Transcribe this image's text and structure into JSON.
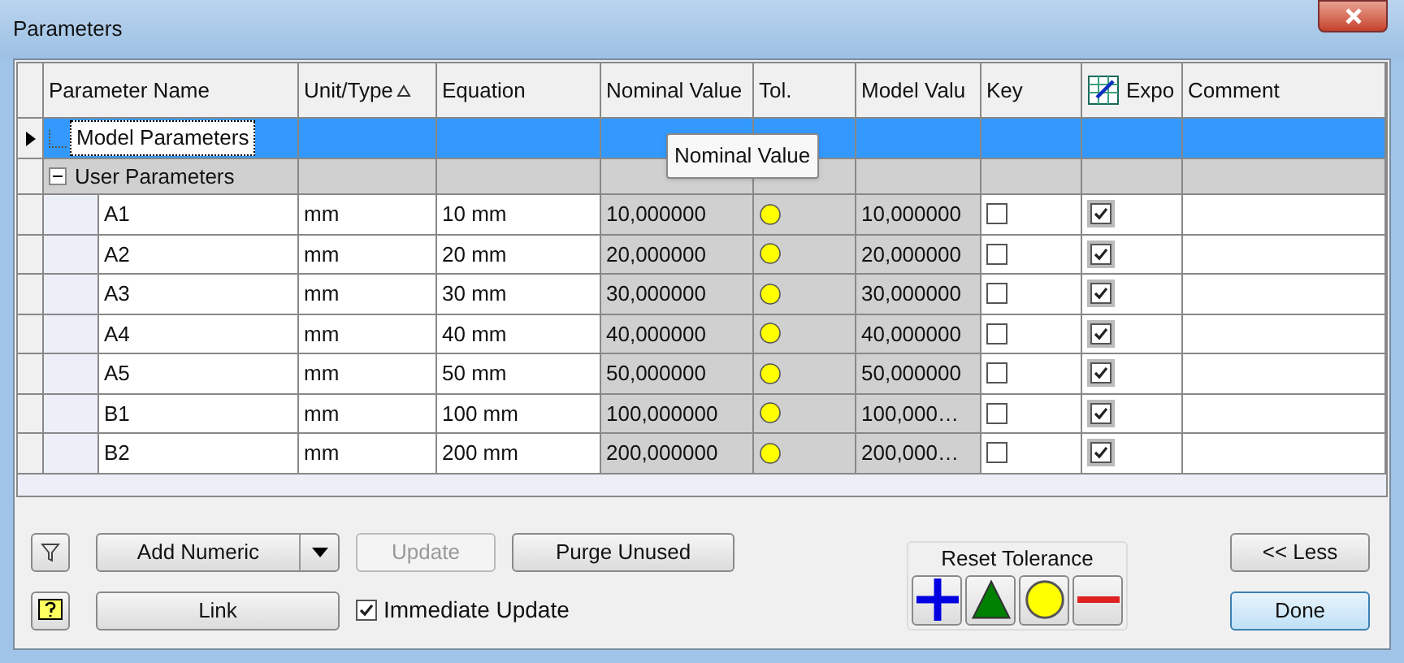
{
  "window": {
    "title": "Parameters"
  },
  "columns": [
    {
      "label": "Parameter Name"
    },
    {
      "label": "Unit/Type",
      "sorted": true
    },
    {
      "label": "Equation"
    },
    {
      "label": "Nominal Value"
    },
    {
      "label": "Tol."
    },
    {
      "label": "Model Valu"
    },
    {
      "label": "Key"
    },
    {
      "label": "Expo",
      "icon": true
    },
    {
      "label": "Comment"
    }
  ],
  "groups": [
    {
      "label": "Model Parameters",
      "selected": true
    },
    {
      "label": "User Parameters",
      "selected": false,
      "expanded": true,
      "children": [
        {
          "name": "A1",
          "unit": "mm",
          "equation": "10 mm",
          "nominal": "10,000000",
          "tol": {
            "kind": "nominal"
          },
          "model": "10,000000",
          "key": false,
          "export": true
        },
        {
          "name": "A2",
          "unit": "mm",
          "equation": "20 mm",
          "nominal": "20,000000",
          "tol": {
            "kind": "nominal"
          },
          "model": "20,000000",
          "key": false,
          "export": true
        },
        {
          "name": "A3",
          "unit": "mm",
          "equation": "30 mm",
          "nominal": "30,000000",
          "tol": {
            "kind": "nominal"
          },
          "model": "30,000000",
          "key": false,
          "export": true
        },
        {
          "name": "A4",
          "unit": "mm",
          "equation": "40 mm",
          "nominal": "40,000000",
          "tol": {
            "kind": "nominal"
          },
          "model": "40,000000",
          "key": false,
          "export": true
        },
        {
          "name": "A5",
          "unit": "mm",
          "equation": "50 mm",
          "nominal": "50,000000",
          "tol": {
            "kind": "nominal"
          },
          "model": "50,000000",
          "key": false,
          "export": true
        },
        {
          "name": "B1",
          "unit": "mm",
          "equation": "100 mm",
          "nominal": "100,000000",
          "tol": {
            "kind": "nominal"
          },
          "model": "100,000…",
          "key": false,
          "export": true
        },
        {
          "name": "B2",
          "unit": "mm",
          "equation": "200 mm",
          "nominal": "200,000000",
          "tol": {
            "kind": "nominal"
          },
          "model": "200,000…",
          "key": false,
          "export": true
        }
      ]
    }
  ],
  "tooltip": "Nominal Value",
  "buttons": {
    "add_numeric": "Add Numeric",
    "update": {
      "label": "Update",
      "disabled": true
    },
    "purge": "Purge Unused",
    "link": "Link",
    "less": "<< Less",
    "done": "Done"
  },
  "immediate_update": {
    "label": "Immediate Update",
    "checked": true
  },
  "reset_tolerance": {
    "label": "Reset Tolerance",
    "tols": [
      {
        "kind": "upper"
      },
      {
        "kind": "median"
      },
      {
        "kind": "nominal"
      },
      {
        "kind": "lower"
      }
    ]
  }
}
